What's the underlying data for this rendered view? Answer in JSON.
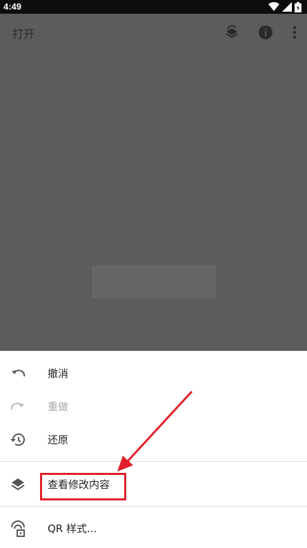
{
  "status_bar": {
    "time": "4:49"
  },
  "app_bar": {
    "title": "打开"
  },
  "menu": {
    "items": [
      {
        "label": "撤消",
        "icon": "undo-icon",
        "enabled": true
      },
      {
        "label": "重做",
        "icon": "redo-icon",
        "enabled": false
      },
      {
        "label": "还原",
        "icon": "restore-history-icon",
        "enabled": true
      },
      {
        "label": "查看修改内容",
        "icon": "layers-icon",
        "enabled": true
      },
      {
        "label": "QR 样式...",
        "icon": "qr-style-icon",
        "enabled": true
      }
    ]
  },
  "colors": {
    "scrim": "#5c5c5c",
    "annotation_red": "#e0202a",
    "disabled_text": "#a8a8a8"
  }
}
